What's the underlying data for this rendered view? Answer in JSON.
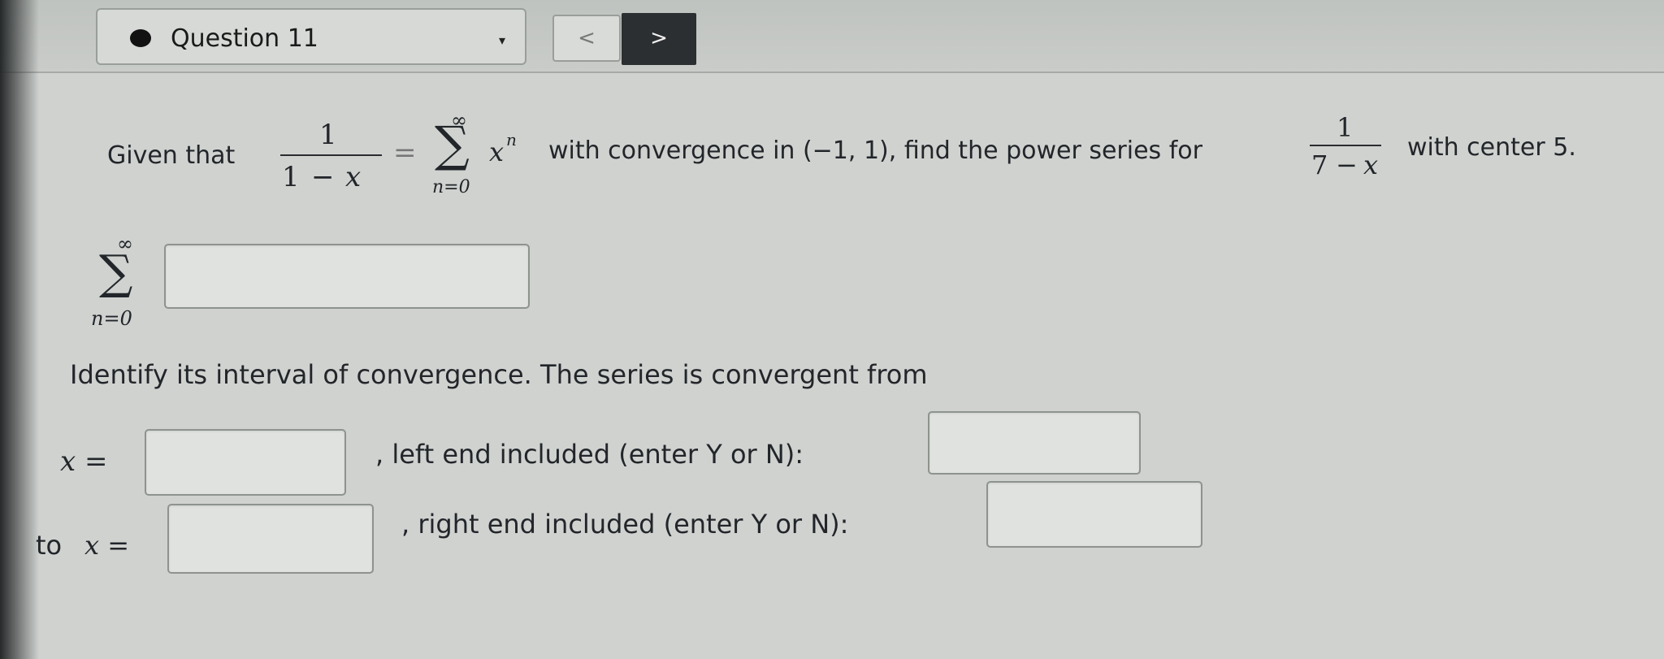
{
  "header": {
    "question_label": "Question 11",
    "dropdown_caret": "▾",
    "prev_symbol": "<",
    "next_symbol": ">"
  },
  "problem": {
    "given_that": "Given that",
    "frac1_num": "1",
    "frac1_den_a": "1",
    "frac1_den_op": "−",
    "frac1_den_var": "x",
    "equals": "=",
    "sum_upper": "∞",
    "sum_symbol": "∑",
    "sum_lower": "n=0",
    "term_base": "x",
    "term_exp": "n",
    "middle_text": "with convergence in (−1, 1), find the power series for",
    "frac2_num": "1",
    "frac2_den_a": "7",
    "frac2_den_op": "−",
    "frac2_den_var": "x",
    "end_text": "with center 5."
  },
  "answer_series": {
    "sum_upper": "∞",
    "sum_symbol": "∑",
    "sum_lower": "n=0"
  },
  "interval": {
    "prompt": "Identify its interval of convergence. The series is convergent from",
    "left_var": "x =",
    "left_suffix": ", left end included (enter Y or N):",
    "right_prefix": "to",
    "right_var": "x =",
    "right_suffix": ", right end included (enter Y or N):"
  },
  "icons": {
    "status_dot": "filled-circle-icon",
    "dropdown": "chevron-down-icon",
    "prev": "chevron-left-icon",
    "next": "chevron-right-icon"
  }
}
